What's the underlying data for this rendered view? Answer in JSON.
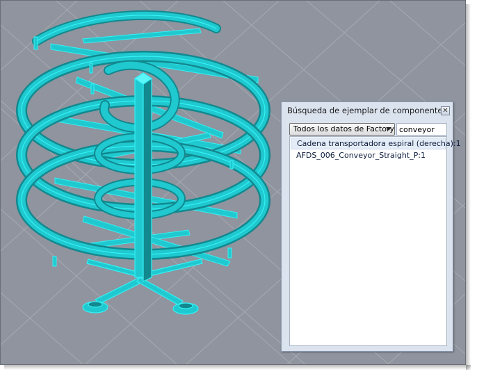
{
  "panel": {
    "title": "Búsqueda de ejemplar de componente",
    "close_glyph": "✕",
    "scope_select": {
      "selected": "Todos los datos de Factory"
    },
    "search": {
      "value": "conveyor"
    },
    "results": [
      {
        "label": "Cadena transportadora espiral (derecha):1",
        "selected": true
      },
      {
        "label": "AFDS_006_Conveyor_Straight_P:1",
        "selected": false
      }
    ]
  },
  "viewport": {
    "background_color": "#8f949e",
    "grid_color": "#a6abb3",
    "model_color": "#1fc9cf",
    "model_edge_color": "#34f1f6",
    "model_dark_color": "#12888f"
  }
}
